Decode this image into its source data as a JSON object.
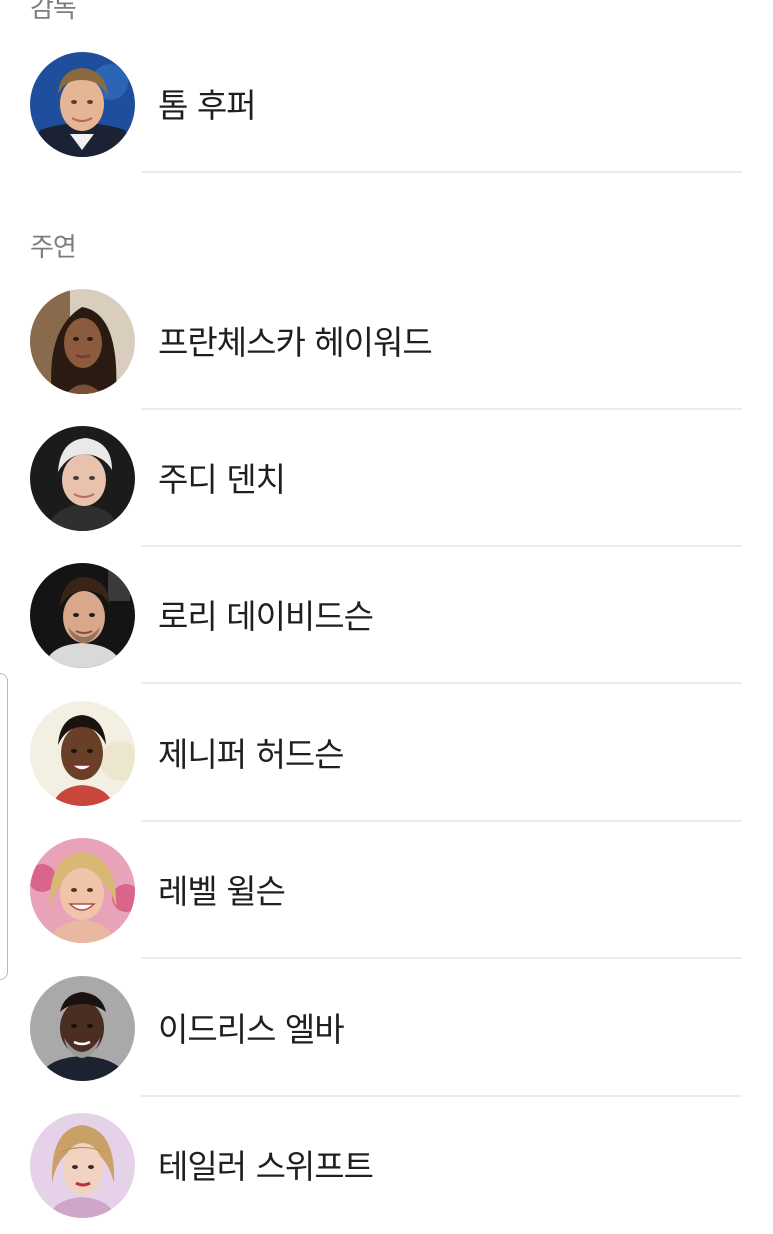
{
  "director_section": {
    "title": "감독",
    "people": [
      {
        "name": "톰 후퍼",
        "avatar_icon": "director-photo-avatar"
      }
    ]
  },
  "cast_section": {
    "title": "주연",
    "people": [
      {
        "name": "프란체스카 헤이워드",
        "avatar_icon": "actor-photo-avatar"
      },
      {
        "name": "주디 덴치",
        "avatar_icon": "actor-photo-avatar"
      },
      {
        "name": "로리 데이비드슨",
        "avatar_icon": "actor-photo-avatar"
      },
      {
        "name": "제니퍼 허드슨",
        "avatar_icon": "actor-photo-avatar"
      },
      {
        "name": "레벨 윌슨",
        "avatar_icon": "actor-photo-avatar"
      },
      {
        "name": "이드리스 엘바",
        "avatar_icon": "actor-photo-avatar"
      },
      {
        "name": "테일러 스위프트",
        "avatar_icon": "actor-photo-avatar"
      }
    ]
  },
  "colors": {
    "section_title": "#7d7d7d",
    "name_text": "#1f1f1f",
    "divider": "#ececec",
    "background": "#ffffff"
  }
}
